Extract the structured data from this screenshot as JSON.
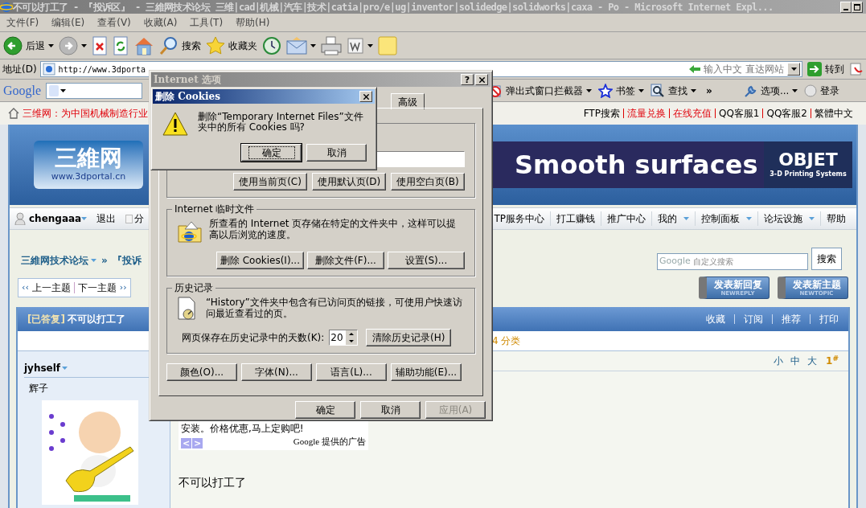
{
  "window": {
    "title": "不可以打工了 - 『投诉区』 - 三維网技术论坛 三维|cad|机械|汽车|技术|catia|pro/e|ug|inventor|solidedge|solidworks|caxa - Po - Microsoft Internet Expl..."
  },
  "menu": [
    "文件(F)",
    "编辑(E)",
    "查看(V)",
    "收藏(A)",
    "工具(T)",
    "帮助(H)"
  ],
  "toolbar": [
    {
      "kind": "back",
      "label": "后退",
      "dropdown": true
    },
    {
      "kind": "forward",
      "dropdown": true
    },
    {
      "kind": "stop",
      "dropdown": false
    },
    {
      "kind": "refresh",
      "dropdown": false
    },
    {
      "kind": "home",
      "dropdown": false
    },
    {
      "kind": "search",
      "label": "搜索",
      "dropdown": false
    },
    {
      "kind": "favorites",
      "label": "收藏夹",
      "dropdown": false
    },
    {
      "kind": "history",
      "dropdown": false
    },
    {
      "kind": "mail",
      "dropdown": true
    },
    {
      "kind": "print",
      "dropdown": false
    },
    {
      "kind": "word",
      "dropdown": true
    },
    {
      "kind": "note",
      "dropdown": false
    }
  ],
  "address": {
    "label": "地址(D)",
    "url": "http://www.3dporta",
    "hint": "输入中文 直达网站",
    "go": "转到"
  },
  "google_bar": {
    "logo": "Google",
    "items": [
      {
        "kind": "popup",
        "label": "弹出式窗口拦截器",
        "dropdown": true
      },
      {
        "kind": "bookmark",
        "label": "书签",
        "dropdown": true
      },
      {
        "kind": "find",
        "label": "查找",
        "dropdown": true
      },
      {
        "kind": "more",
        "label": "»",
        "dropdown": false
      },
      {
        "kind": "options",
        "label": "选项...",
        "dropdown": true
      },
      {
        "kind": "login",
        "label": "登录",
        "dropdown": false
      }
    ]
  },
  "page": {
    "slogan": "三维网：为中国机械制造行业",
    "top_links": [
      {
        "label": "FTP搜索",
        "highlight": false
      },
      {
        "label": "流量兑换",
        "highlight": true
      },
      {
        "label": "在线充值",
        "highlight": true
      },
      {
        "label": "QQ客服1",
        "highlight": false
      },
      {
        "label": "QQ客服2",
        "highlight": false
      },
      {
        "label": "繁體中文",
        "highlight": false
      }
    ],
    "logo": {
      "title": "三維网",
      "url": "www.3dportal.cn"
    },
    "ad_banner": {
      "headline": "Smooth surfaces",
      "brand": "OBJET",
      "tagline": "3-D Printing Systems"
    },
    "user": {
      "name": "chengaaa",
      "logout": "退出",
      "extra": "分"
    },
    "nav": [
      {
        "label": "TP服务中心",
        "dropdown": false
      },
      {
        "label": "打工赚钱",
        "dropdown": false
      },
      {
        "label": "推广中心",
        "dropdown": false
      },
      {
        "label": "我的",
        "dropdown": true
      },
      {
        "label": "控制面板",
        "dropdown": true
      },
      {
        "label": "论坛设施",
        "dropdown": true
      },
      {
        "label": "帮助",
        "dropdown": false
      }
    ],
    "breadcrumb": [
      {
        "label": "三維网技术论坛",
        "dropdown": true
      },
      {
        "label": "»",
        "dropdown": false
      },
      {
        "label": "『投诉",
        "dropdown": false
      }
    ],
    "site_search": {
      "brand": "Google",
      "placeholder": "自定义搜索",
      "button": "搜索"
    },
    "thread_nav": [
      {
        "arrow": "‹‹",
        "label": "上一主题"
      },
      {
        "arrow": "››",
        "label": "下一主题"
      }
    ],
    "post_buttons": [
      {
        "label": "发表新回复",
        "sub": "NEWREPLY"
      },
      {
        "label": "发表新主题",
        "sub": "NEWTOPIC"
      }
    ],
    "thread": {
      "status": "[已答复]",
      "title": "不可以打工了",
      "actions": [
        "收藏",
        "订阅",
        "推荐",
        "打印"
      ],
      "category": "4 分类"
    },
    "post": {
      "author": "jyhself",
      "nickname": "辉子",
      "avatar": {
        "kind": "picture"
      },
      "font_sizes": [
        "小",
        "中",
        "大"
      ],
      "floor": "1$^{#}$",
      "ad_text": "安装。价格优惠,马上定购吧!",
      "ad_nav": [
        "<",
        ">"
      ],
      "ad_credit": "Google 提供的广告",
      "body": "不可以打工了"
    }
  },
  "options_dialog": {
    "title": "Internet 选项",
    "help": "?",
    "tab": {
      "label": "高级",
      "selected": false
    },
    "home_buttons": [
      "使用当前页(C)",
      "使用默认页(D)",
      "使用空白页(B)"
    ],
    "temp_files": {
      "title": "Internet 临时文件",
      "description": "所查看的 Internet 页存储在特定的文件夹中，这样可以提高以后浏览的速度。",
      "buttons": [
        "删除 Cookies(I)...",
        "删除文件(F)...",
        "设置(S)..."
      ]
    },
    "history": {
      "title": "历史记录",
      "description": "“History”文件夹中包含有已访问页的链接，可使用户快速访问最近查看过的页。",
      "days_label": "网页保存在历史记录中的天数(K):",
      "days": "20",
      "clear": "清除历史记录(H)"
    },
    "bottom_buttons": [
      "颜色(O)...",
      "字体(N)...",
      "语言(L)...",
      "辅助功能(E)..."
    ],
    "footer": [
      {
        "label": "确定",
        "disabled": false
      },
      {
        "label": "取消",
        "disabled": false
      },
      {
        "label": "应用(A)",
        "disabled": true
      }
    ]
  },
  "cookie_dialog": {
    "title": "删除 Cookies",
    "message": "删除“Temporary Internet Files”文件夹中的所有 Cookies 吗?",
    "buttons": [
      {
        "label": "确定",
        "focused": true
      },
      {
        "label": "取消",
        "focused": false
      }
    ]
  }
}
